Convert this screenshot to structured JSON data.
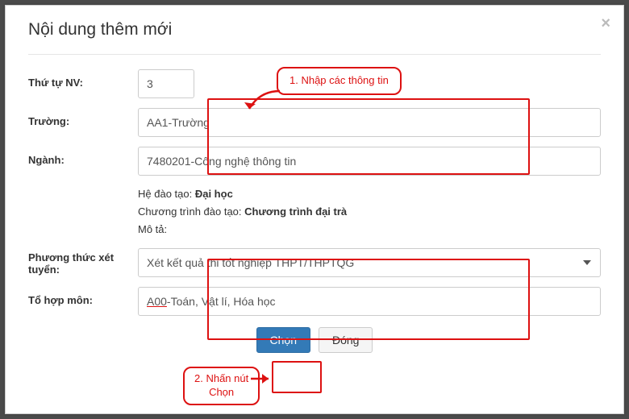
{
  "modal": {
    "title": "Nội dung thêm mới",
    "close_symbol": "×"
  },
  "fields": {
    "thutu_label": "Thứ tự NV:",
    "thutu_value": "3",
    "truong_label": "Trường:",
    "truong_value": "AA1-Trường",
    "nganh_label": "Ngành:",
    "nganh_value": "7480201-Công nghệ thông tin",
    "phuongthuc_label": "Phương thức xét tuyển:",
    "phuongthuc_value": "Xét kết quả thi tốt nghiệp THPT/THPTQG",
    "tohop_label": "Tổ hợp môn:",
    "tohop_prefix": "A00",
    "tohop_rest": "-Toán, Vật lí, Hóa học"
  },
  "info": {
    "hedaotao_k": "Hệ đào tạo:",
    "hedaotao_v": "Đại học",
    "chuongtrinh_k": "Chương trình đào tạo:",
    "chuongtrinh_v": "Chương trình đại trà",
    "mota_k": "Mô tả:"
  },
  "buttons": {
    "chon": "Chọn",
    "dong": "Đóng"
  },
  "annotations": {
    "step1": "1. Nhập các thông tin",
    "step2_l1": "2. Nhấn nút",
    "step2_l2": "Chọn"
  }
}
